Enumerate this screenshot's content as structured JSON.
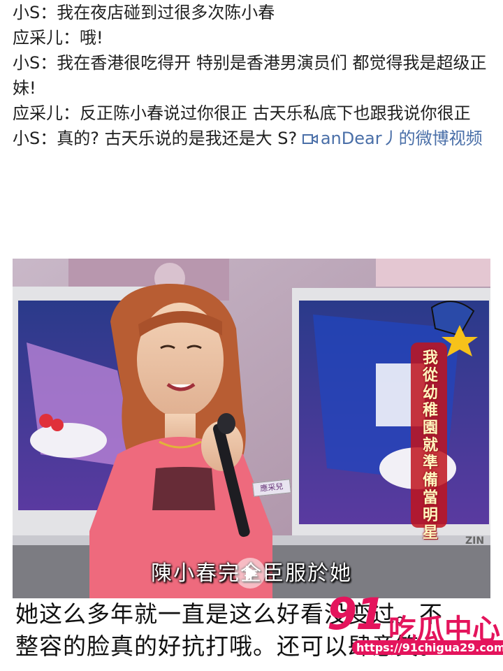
{
  "post": {
    "lines": [
      "小S：我在夜店碰到过很多次陈小春",
      "应采儿：哦!",
      "小S：我在香港很吃得开 特别是香港男演员们 都觉得我是超级正妹!",
      "应采儿：反正陈小春说过你很正 古天乐私底下也跟我说你很正",
      "小S：真的? 古天乐说的是我还是大 S?"
    ],
    "video_link": "anDear丿的微博视频",
    "video_icon": "video-camera-icon",
    "link_color": "#4a6fa8"
  },
  "video": {
    "subtitle": "陳小春完全臣服於她",
    "name_tag": "應采兒",
    "side_banner": "我從幼稚園就準備當明星",
    "studio_logo": "ZIN",
    "play_icon": "play-icon"
  },
  "bottom_caption": {
    "line1": "她这么多年就一直是这么好看没变过。不",
    "line2": "整容的脸真的好抗打哦。还可以肆意笑。"
  },
  "watermark": {
    "logo": "91",
    "name": "吃瓜中心",
    "url": "https://91chigua29.com",
    "color": "#e4145c"
  }
}
